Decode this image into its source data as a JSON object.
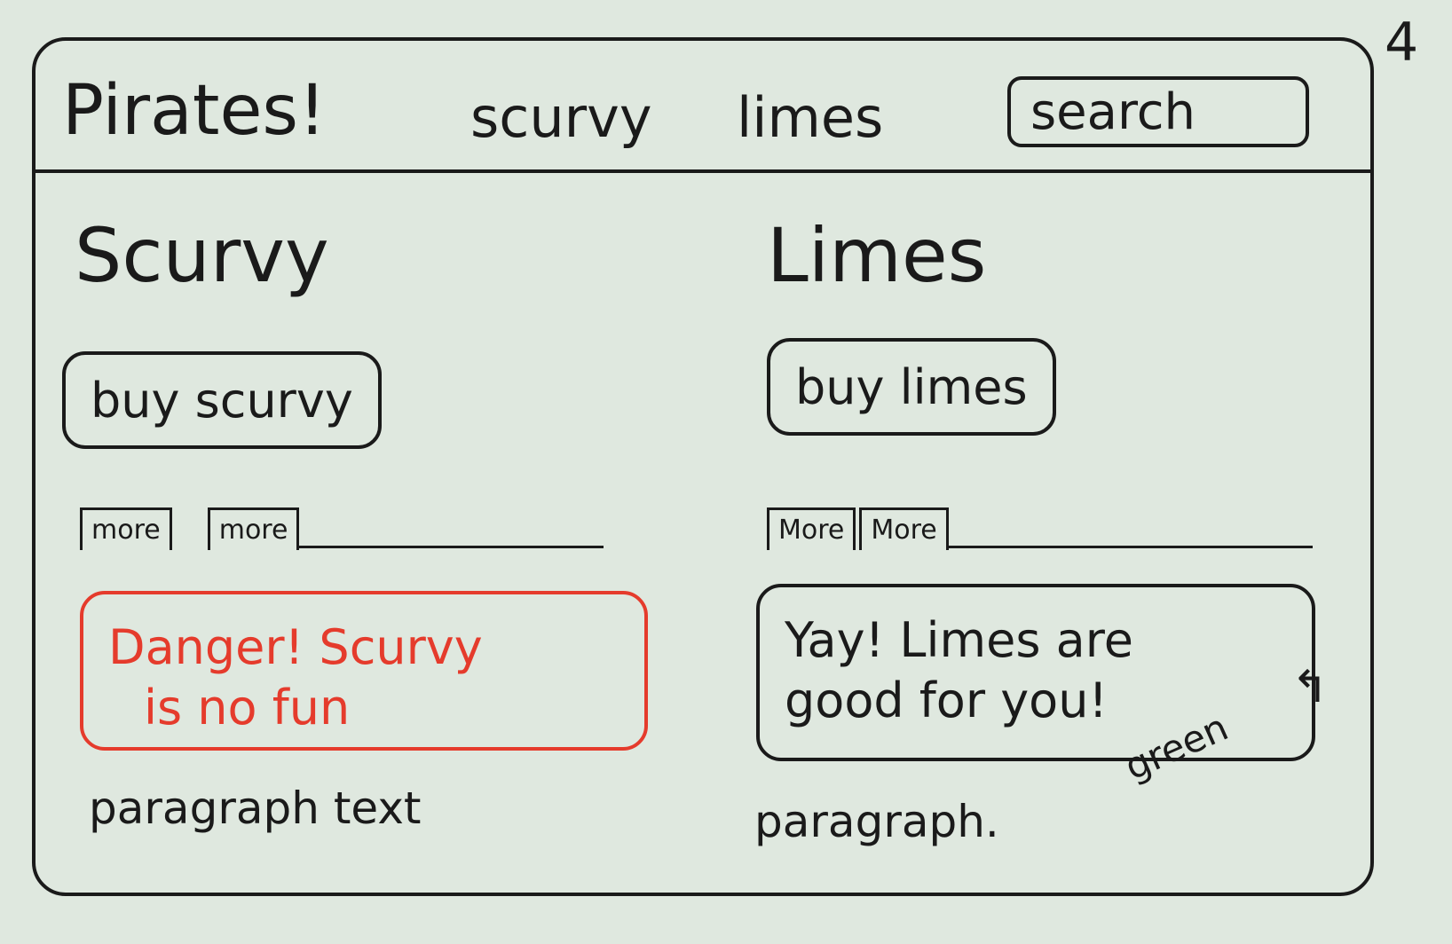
{
  "page_number": "4",
  "header": {
    "brand": "Pirates!",
    "nav": [
      "scurvy",
      "limes"
    ],
    "search_placeholder": "search"
  },
  "sections": [
    {
      "title": "Scurvy",
      "button": "buy scurvy",
      "tabs": [
        "more",
        "more"
      ],
      "alert": {
        "variant": "danger",
        "color": "#e53b2c",
        "line1": "Danger! Scurvy",
        "line2": "is no fun"
      },
      "paragraph": "paragraph text"
    },
    {
      "title": "Limes",
      "button": "buy limes",
      "tabs": [
        "More",
        "More"
      ],
      "alert": {
        "variant": "success",
        "line1": "Yay! Limes are",
        "line2": "good for you!"
      },
      "paragraph": "paragraph."
    }
  ],
  "annotation": {
    "text": "green",
    "icon": "curved-arrow-icon"
  }
}
